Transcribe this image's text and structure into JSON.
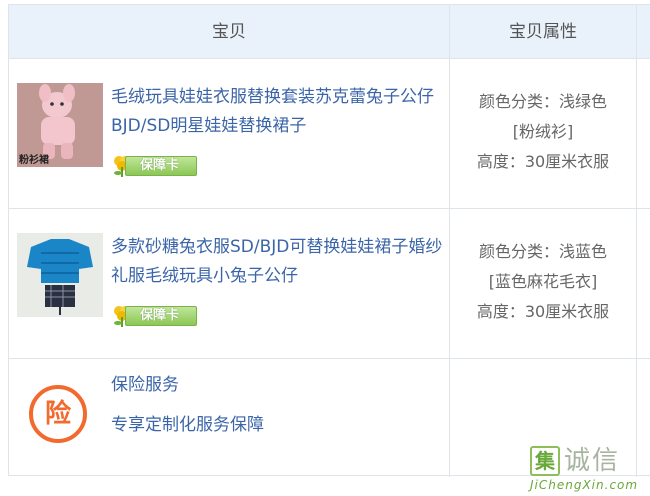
{
  "header": {
    "col_item": "宝贝",
    "col_attrs": "宝贝属性"
  },
  "rows": [
    {
      "title": "毛绒玩具娃娃衣服替换套装苏克蕾兔子公仔BJD/SD明星娃娃替换裙子",
      "badge": "保障卡",
      "thumb_caption": "粉衫裙",
      "props": [
        "颜色分类：浅绿色",
        "[粉绒衫]",
        "高度：30厘米衣服"
      ]
    },
    {
      "title": "多款砂糖兔衣服SD/BJD可替换娃娃裙子婚纱礼服毛绒玩具小兔子公仔",
      "badge": "保障卡",
      "props": [
        "颜色分类：浅蓝色",
        "[蓝色麻花毛衣]",
        "高度：30厘米衣服"
      ]
    }
  ],
  "insurance": {
    "icon_char": "险",
    "title": "保险服务",
    "desc": "专享定制化服务保障"
  },
  "watermark": {
    "box_char": "集",
    "text": "诚信",
    "url": "JiChengXin.com"
  },
  "colors": {
    "header_bg": "#e9f1fb",
    "link": "#3b65a8",
    "border": "#dfe3ea",
    "badge_green": "#8cc754",
    "insurance_orange": "#f26a2e"
  }
}
